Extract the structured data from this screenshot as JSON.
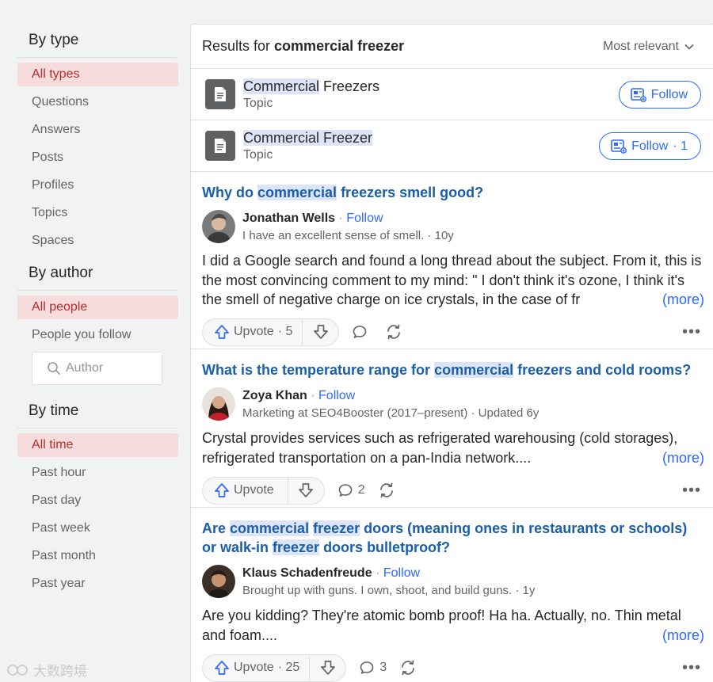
{
  "sidebar": {
    "by_type": {
      "title": "By type",
      "items": [
        "All types",
        "Questions",
        "Answers",
        "Posts",
        "Profiles",
        "Topics",
        "Spaces"
      ]
    },
    "by_author": {
      "title": "By author",
      "items": [
        "All people",
        "People you follow"
      ],
      "author_placeholder": "Author"
    },
    "by_time": {
      "title": "By time",
      "items": [
        "All time",
        "Past hour",
        "Past day",
        "Past week",
        "Past month",
        "Past year"
      ]
    }
  },
  "header": {
    "results_prefix": "Results for",
    "query": "commercial freezer",
    "sort_label": "Most relevant"
  },
  "topics": [
    {
      "name_hl": "Commercial",
      "name_rest": " Freezers",
      "sub": "Topic",
      "follow_label": "Follow",
      "follow_count": ""
    },
    {
      "name_hl1": "Commercial",
      "name_mid": " ",
      "name_hl2": "Freezer",
      "sub": "Topic",
      "follow_label": "Follow",
      "follow_count": "· 1"
    }
  ],
  "answers": [
    {
      "title_parts": [
        "Why do ",
        "commercial",
        " freezers smell good?"
      ],
      "author": "Jonathan Wells",
      "follow": "Follow",
      "credential": "I have an excellent sense of smell. · 10y",
      "body": "I did a Google search and found a long thread about the subject. From it, this is the most convincing comment to my mind: \" I don't think it's ozone, I think it's the smell of negative charge on ice crystals, in the case of fr",
      "more": "(more)",
      "upvote": "Upvote",
      "upvote_count": "· 5",
      "comments": "",
      "share": ""
    },
    {
      "title_parts": [
        "What is the temperature range for ",
        "commercial",
        " freezers and cold rooms?"
      ],
      "author": "Zoya Khan",
      "follow": "Follow",
      "credential": "Marketing at SEO4Booster (2017–present) · Updated 6y",
      "body": "Crystal provides services such as refrigerated warehousing (cold storages), refrigerated transportation on a pan-India network....",
      "more": "(more)",
      "upvote": "Upvote",
      "upvote_count": "",
      "comments": "2",
      "share": ""
    },
    {
      "title_parts": [
        "Are ",
        "commercial",
        " ",
        "freezer",
        " doors (meaning ones in restaurants or schools) or walk-in ",
        "freezer",
        " doors bulletproof?"
      ],
      "author": "Klaus Schadenfreude",
      "follow": "Follow",
      "credential": "Brought up with guns. I own, shoot, and build guns. · 1y",
      "body": "Are you kidding? They're atomic bomb proof! Ha ha. Actually, no. Thin metal and foam....",
      "more": "(more)",
      "upvote": "Upvote",
      "upvote_count": "· 25",
      "comments": "3",
      "share": ""
    }
  ],
  "watermark": "大数跨境",
  "colors": {
    "accent": "#2e69ff",
    "link": "#195faa",
    "active_bg": "#f6dcdc",
    "active_text": "#b92b27"
  }
}
